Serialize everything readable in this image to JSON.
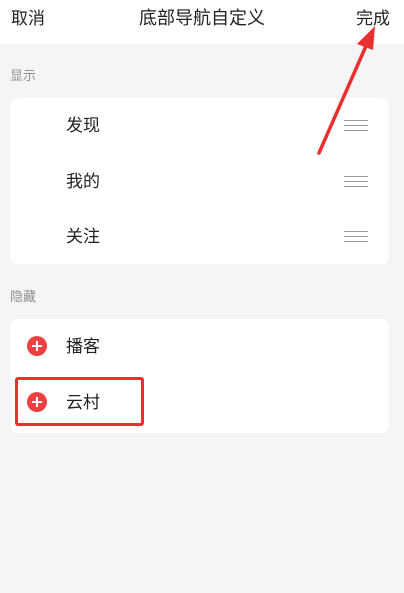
{
  "header": {
    "cancel_label": "取消",
    "title": "底部导航自定义",
    "done_label": "完成"
  },
  "sections": {
    "shown": {
      "label": "显示",
      "items": [
        {
          "label": "发现"
        },
        {
          "label": "我的"
        },
        {
          "label": "关注"
        }
      ]
    },
    "hidden": {
      "label": "隐藏",
      "items": [
        {
          "label": "播客"
        },
        {
          "label": "云村"
        }
      ]
    }
  },
  "icons": {
    "drag_handle": "drag-handle-icon",
    "add": "add-circle-icon"
  },
  "colors": {
    "accent": "#ec4141",
    "annotation": "#e8302e",
    "background": "#f5f5f7"
  }
}
